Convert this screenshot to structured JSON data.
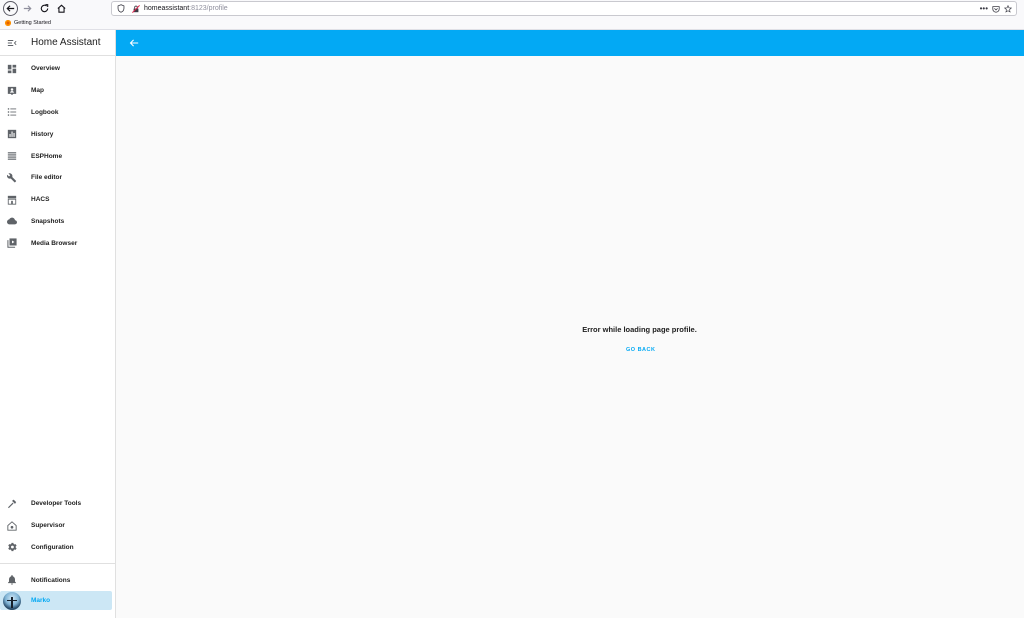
{
  "browser": {
    "url_host": "homeassistant",
    "url_path": ":8123/profile",
    "page_actions": "•••",
    "bookmarks": [
      {
        "label": "Getting Started"
      }
    ]
  },
  "sidebar": {
    "title": "Home Assistant",
    "items": [
      {
        "label": "Overview",
        "icon": "dashboard-icon"
      },
      {
        "label": "Map",
        "icon": "map-icon"
      },
      {
        "label": "Logbook",
        "icon": "logbook-icon"
      },
      {
        "label": "History",
        "icon": "history-chart-icon"
      },
      {
        "label": "ESPHome",
        "icon": "esphome-icon"
      },
      {
        "label": "File editor",
        "icon": "wrench-icon"
      },
      {
        "label": "HACS",
        "icon": "hacs-icon"
      },
      {
        "label": "Snapshots",
        "icon": "cloud-icon"
      },
      {
        "label": "Media Browser",
        "icon": "media-icon"
      }
    ],
    "bottom_items": [
      {
        "label": "Developer Tools",
        "icon": "hammer-icon"
      },
      {
        "label": "Supervisor",
        "icon": "supervisor-icon"
      },
      {
        "label": "Configuration",
        "icon": "gear-icon"
      }
    ],
    "notifications": {
      "label": "Notifications",
      "icon": "bell-icon"
    },
    "user": {
      "label": "Marko"
    }
  },
  "main": {
    "error_message": "Error while loading page profile.",
    "go_back_label": "GO BACK"
  },
  "colors": {
    "accent": "#03a9f4",
    "active_item_bg": "#cce7f5",
    "content_bg": "#fafafa"
  }
}
